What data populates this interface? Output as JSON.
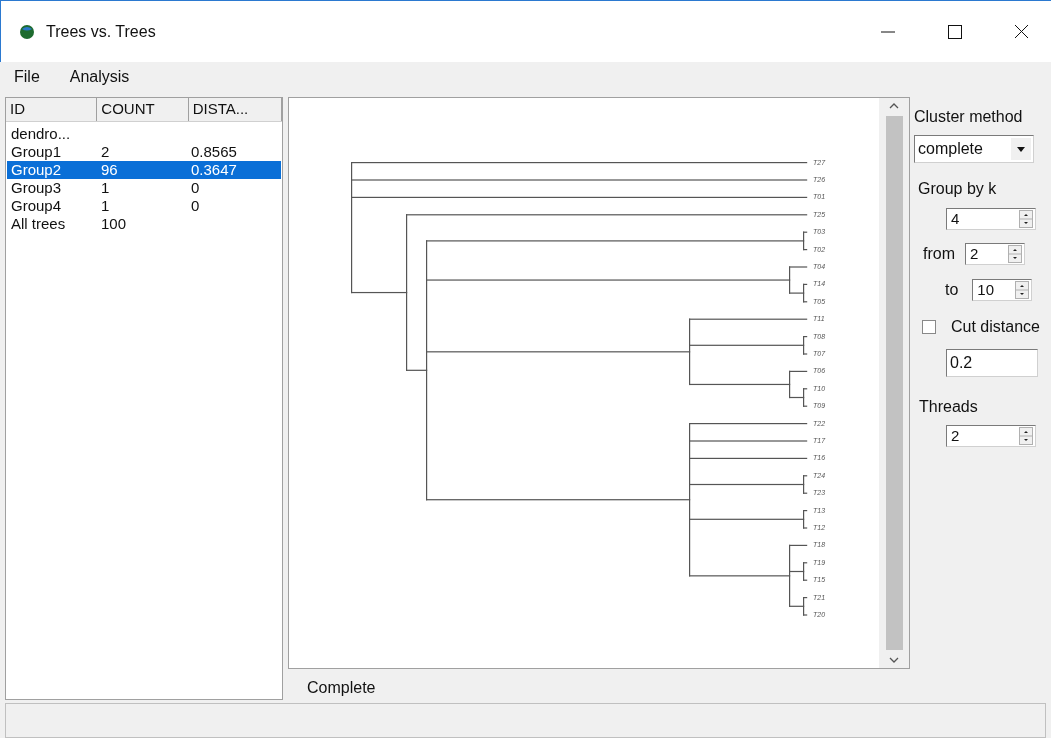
{
  "window": {
    "title": "Trees vs. Trees"
  },
  "menu": [
    "File",
    "Analysis"
  ],
  "table": {
    "columns": [
      "ID",
      "COUNT",
      "DISTA..."
    ],
    "rows": [
      {
        "id": "dendro...",
        "selected": false
      },
      {
        "id": "Group1",
        "count": "2",
        "distance": "0.8565",
        "selected": false
      },
      {
        "id": "Group2",
        "count": "96",
        "distance": "0.3647",
        "selected": true
      },
      {
        "id": "Group3",
        "count": "1",
        "distance": "0",
        "selected": false
      },
      {
        "id": "Group4",
        "count": "1",
        "distance": "0",
        "selected": false
      },
      {
        "id": "All trees",
        "count": "100",
        "selected": false
      }
    ]
  },
  "dendrogram": {
    "tree": {
      "children": [
        {
          "label": "T27"
        },
        {
          "label": "T26"
        },
        {
          "label": "T01"
        },
        {
          "children": [
            {
              "label": "T25"
            },
            {
              "children": [
                {
                  "children": [
                    {
                      "label": "T03"
                    },
                    {
                      "label": "T02"
                    }
                  ]
                },
                {
                  "children": [
                    {
                      "label": "T04"
                    },
                    {
                      "children": [
                        {
                          "label": "T14"
                        },
                        {
                          "label": "T05"
                        }
                      ]
                    }
                  ]
                },
                {
                  "children": [
                    {
                      "label": "T11"
                    },
                    {
                      "children": [
                        {
                          "label": "T08"
                        },
                        {
                          "label": "T07"
                        }
                      ]
                    },
                    {
                      "children": [
                        {
                          "label": "T06"
                        },
                        {
                          "children": [
                            {
                              "label": "T10"
                            },
                            {
                              "label": "T09"
                            }
                          ]
                        }
                      ]
                    }
                  ]
                },
                {
                  "children": [
                    {
                      "label": "T22"
                    },
                    {
                      "label": "T17"
                    },
                    {
                      "label": "T16"
                    },
                    {
                      "children": [
                        {
                          "label": "T24"
                        },
                        {
                          "label": "T23"
                        }
                      ]
                    },
                    {
                      "children": [
                        {
                          "label": "T13"
                        },
                        {
                          "label": "T12"
                        }
                      ]
                    },
                    {
                      "children": [
                        {
                          "label": "T18"
                        },
                        {
                          "children": [
                            {
                              "label": "T19"
                            },
                            {
                              "label": "T15"
                            }
                          ]
                        },
                        {
                          "children": [
                            {
                              "label": "T21"
                            },
                            {
                              "label": "T20"
                            }
                          ]
                        }
                      ]
                    }
                  ]
                }
              ]
            }
          ]
        }
      ]
    },
    "caption": "Complete"
  },
  "options": {
    "cluster_method": {
      "label": "Cluster method",
      "value": "complete"
    },
    "group_by_k": {
      "label": "Group by k",
      "value": "4"
    },
    "from": {
      "label": "from",
      "value": "2"
    },
    "to": {
      "label": "to",
      "value": "10"
    },
    "cut_distance": {
      "label": "Cut distance",
      "checked": false,
      "value": "0.2"
    },
    "threads": {
      "label": "Threads",
      "value": "2"
    }
  }
}
